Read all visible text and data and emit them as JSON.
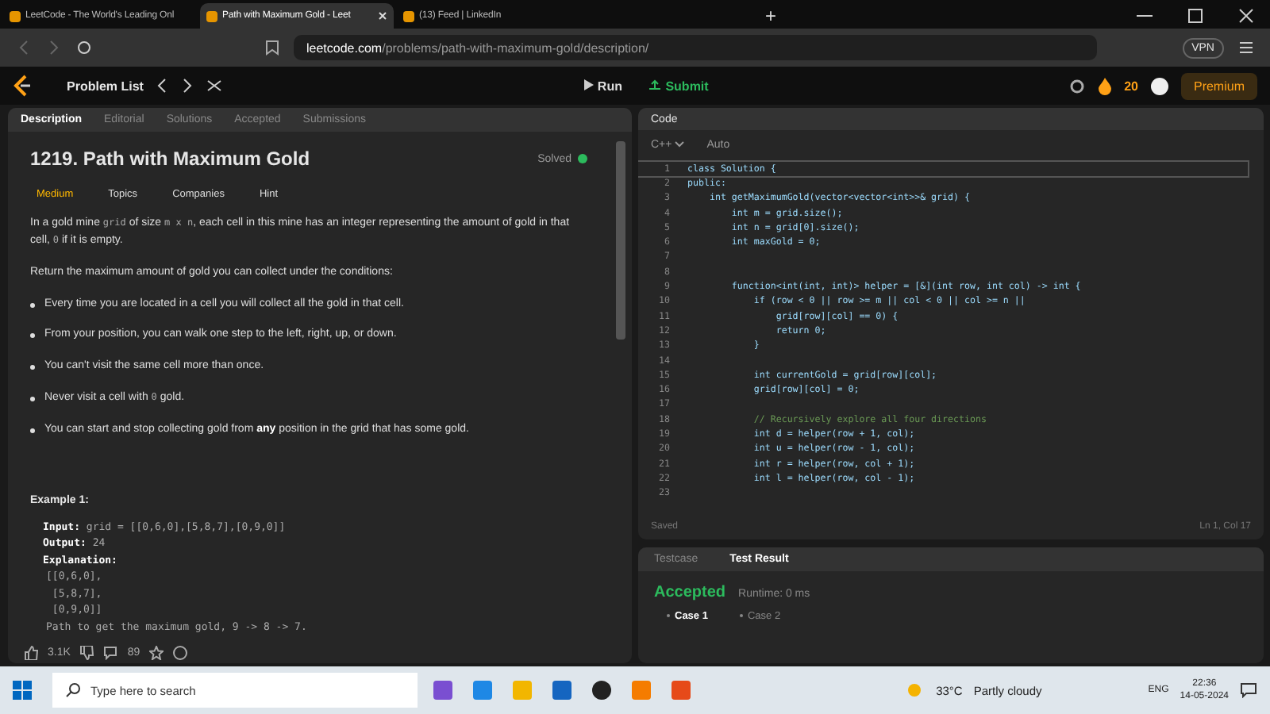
{
  "browser": {
    "tabs": [
      {
        "title": "LeetCode - The World's Leading Onl",
        "selected": false
      },
      {
        "title": "Path with Maximum Gold - Leet",
        "selected": true
      },
      {
        "title": "(13) Feed | LinkedIn",
        "selected": false
      }
    ],
    "new_tab": "+",
    "url_host": "leetcode.com",
    "url_path": "/problems/path-with-maximum-gold/description/",
    "vpn": "VPN"
  },
  "nav": {
    "problem_list": "Problem List",
    "run": "Run",
    "submit": "Submit",
    "streak": "20",
    "premium": "Premium"
  },
  "description": {
    "tabs": [
      {
        "label": "Description",
        "selected": true
      },
      {
        "label": "Editorial",
        "selected": false
      },
      {
        "label": "Solutions",
        "selected": false
      },
      {
        "label": "Accepted",
        "selected": false
      },
      {
        "label": "Submissions",
        "selected": false
      }
    ],
    "title": "1219. Path with Maximum Gold",
    "status": "Solved",
    "difficulty": "Medium",
    "tags": [
      "Topics",
      "Companies",
      "Hint"
    ],
    "paragraphs": [
      [
        {
          "kind": "text",
          "text": "In a gold mine "
        },
        {
          "kind": "code",
          "text": "grid"
        },
        {
          "kind": "text",
          "text": " of size "
        },
        {
          "kind": "code",
          "text": "m x n"
        },
        {
          "kind": "text",
          "text": ", each cell in this mine has an integer representing the amount of gold in that cell, "
        },
        {
          "kind": "code",
          "text": "0"
        },
        {
          "kind": "text",
          "text": " if it is empty."
        }
      ],
      [
        {
          "kind": "text",
          "text": "Return the maximum amount of gold you can collect under the conditions:"
        }
      ]
    ],
    "bullets": [
      [
        {
          "kind": "text",
          "text": "Every time you are located in a cell you will collect all the gold in that cell."
        }
      ],
      [
        {
          "kind": "text",
          "text": "From your position, you can walk one step to the left, right, up, or down."
        }
      ],
      [
        {
          "kind": "text",
          "text": "You can't visit the same cell more than once."
        }
      ],
      [
        {
          "kind": "text",
          "text": "Never visit a cell with "
        },
        {
          "kind": "code",
          "text": "0"
        },
        {
          "kind": "text",
          "text": " gold."
        }
      ],
      [
        {
          "kind": "text",
          "text": "You can start and stop collecting gold from "
        },
        {
          "kind": "bold",
          "text": "any"
        },
        {
          "kind": "text",
          "text": " position in the grid that has some gold."
        }
      ]
    ],
    "example": {
      "heading": "Example 1:",
      "input_label": "Input:",
      "input": "grid = [[0,6,0],[5,8,7],[0,9,0]]",
      "output_label": "Output:",
      "output": "24",
      "explanation_label": "Explanation:",
      "explanation": [
        "[[0,6,0],",
        " [5,8,7],",
        " [0,9,0]]",
        "Path to get the maximum gold, 9 -> 8 -> 7."
      ]
    },
    "likes": "3.1K",
    "comments": "89"
  },
  "code": {
    "title": "Code",
    "language": "C++",
    "mode": "Auto",
    "lines": [
      {
        "n": "1",
        "kind": "code",
        "text": "class Solution {"
      },
      {
        "n": "2",
        "kind": "code",
        "text": "public:"
      },
      {
        "n": "3",
        "kind": "code",
        "text": "    int getMaximumGold(vector<vector<int>>& grid) {"
      },
      {
        "n": "4",
        "kind": "code",
        "text": "        int m = grid.size();"
      },
      {
        "n": "5",
        "kind": "code",
        "text": "        int n = grid[0].size();"
      },
      {
        "n": "6",
        "kind": "code",
        "text": "        int maxGold = 0;"
      },
      {
        "n": "7"
      },
      {
        "n": "8"
      },
      {
        "n": "9",
        "kind": "code",
        "text": "        function<int(int, int)> helper = [&](int row, int col) -> int {"
      },
      {
        "n": "10",
        "kind": "code",
        "text": "            if (row < 0 || row >= m || col < 0 || col >= n ||"
      },
      {
        "n": "11",
        "kind": "code",
        "text": "                grid[row][col] == 0) {"
      },
      {
        "n": "12",
        "kind": "code",
        "text": "                return 0;"
      },
      {
        "n": "13",
        "kind": "code",
        "text": "            }"
      },
      {
        "n": "14"
      },
      {
        "n": "15",
        "kind": "code",
        "text": "            int currentGold = grid[row][col];"
      },
      {
        "n": "16",
        "kind": "code",
        "text": "            grid[row][col] = 0;"
      },
      {
        "n": "17"
      },
      {
        "n": "18",
        "kind": "comment",
        "text": "            // Recursively explore all four directions"
      },
      {
        "n": "19",
        "kind": "code",
        "text": "            int d = helper(row + 1, col);"
      },
      {
        "n": "20",
        "kind": "code",
        "text": "            int u = helper(row - 1, col);"
      },
      {
        "n": "21",
        "kind": "code",
        "text": "            int r = helper(row, col + 1);"
      },
      {
        "n": "22",
        "kind": "code",
        "text": "            int l = helper(row, col - 1);"
      },
      {
        "n": "23"
      }
    ],
    "status": "Saved",
    "position": "Ln 1, Col 17"
  },
  "result": {
    "tabs": [
      {
        "label": "Testcase",
        "selected": false
      },
      {
        "label": "Test Result",
        "selected": true
      }
    ],
    "verdict": "Accepted",
    "runtime": "Runtime: 0 ms",
    "cases": [
      {
        "label": "Case 1",
        "selected": true
      },
      {
        "label": "Case 2",
        "selected": false
      }
    ]
  },
  "taskbar": {
    "search_placeholder": "Type here to search",
    "temperature": "33°C",
    "weather": "Partly cloudy",
    "language": "ENG",
    "time": "22:36",
    "date": "14-05-2024"
  }
}
